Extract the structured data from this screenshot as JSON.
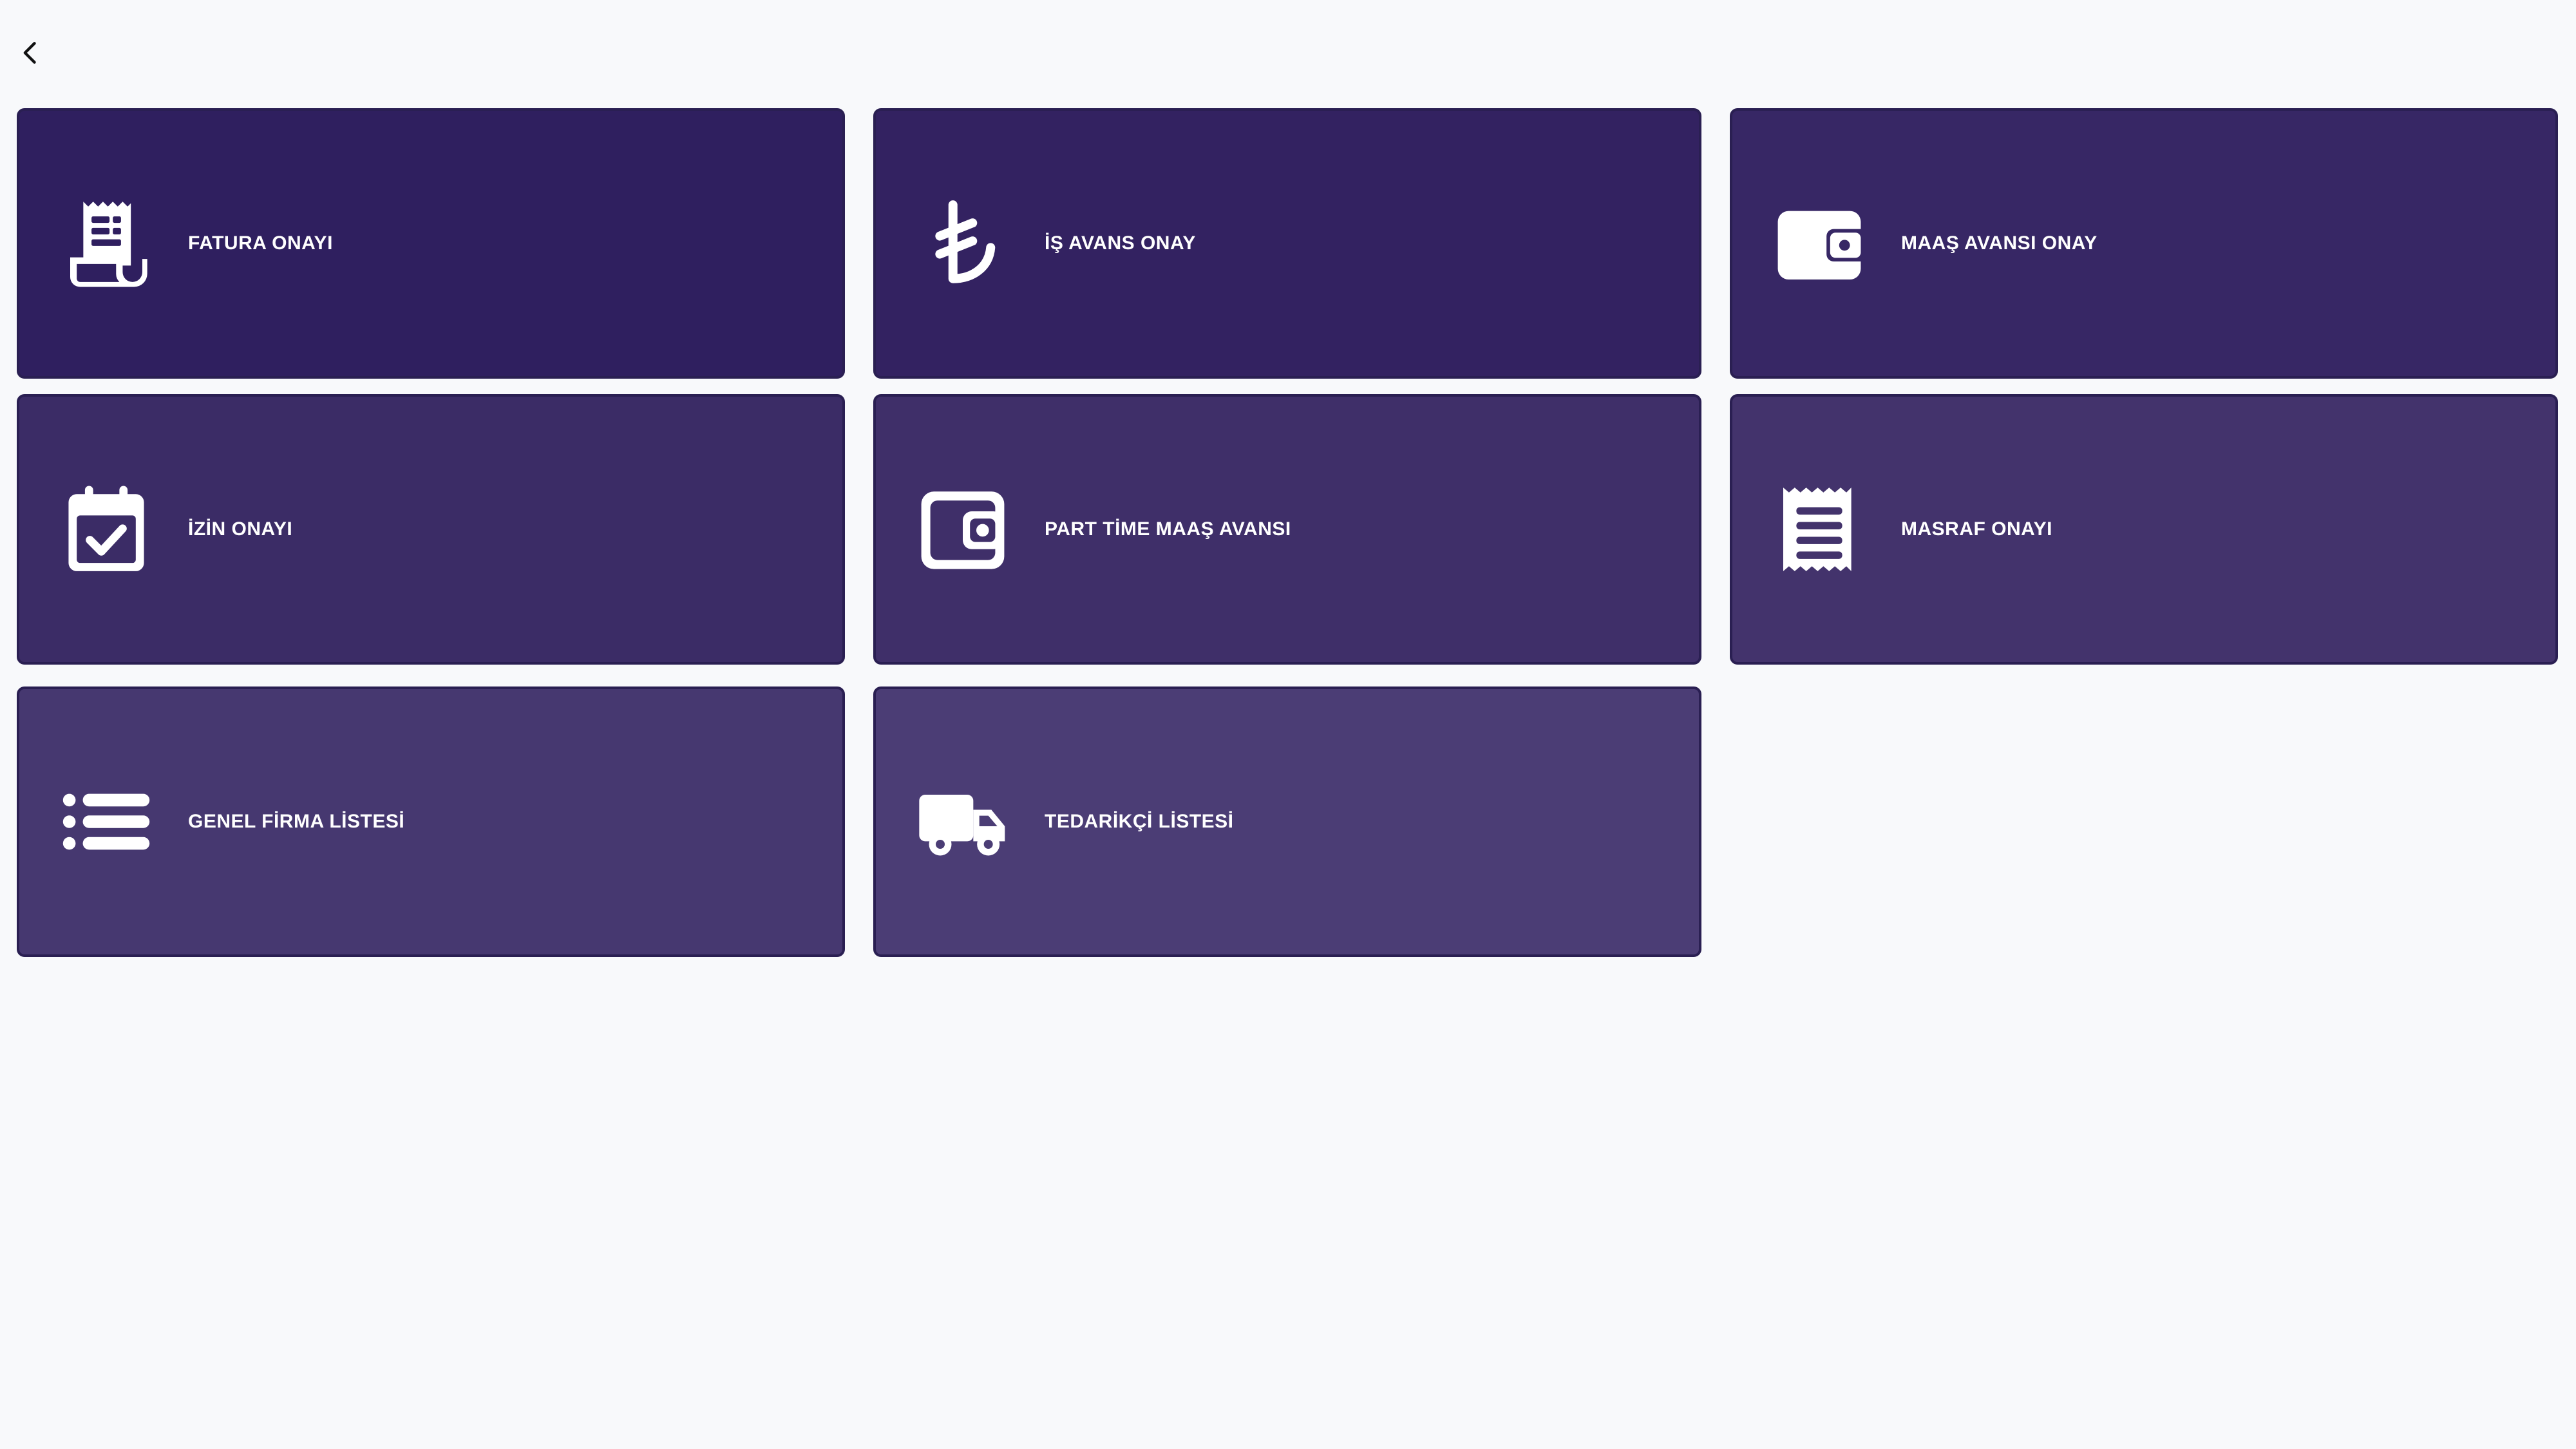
{
  "toolbar": {
    "back_icon": "chevron-left-icon"
  },
  "tiles": [
    {
      "label": "FATURA ONAYI",
      "icon": "invoice-receipt-icon"
    },
    {
      "label": "İŞ AVANS ONAY",
      "icon": "turkish-lira-icon"
    },
    {
      "label": "MAAŞ AVANSI ONAY",
      "icon": "wallet-icon"
    },
    {
      "label": "İZİN ONAYI",
      "icon": "calendar-check-icon"
    },
    {
      "label": "PART TİME MAAŞ AVANSI",
      "icon": "wallet-outline-icon"
    },
    {
      "label": "MASRAF ONAYI",
      "icon": "receipt-icon"
    },
    {
      "label": "GENEL FİRMA LİSTESİ",
      "icon": "list-icon"
    },
    {
      "label": "TEDARİKÇİ LİSTESİ",
      "icon": "truck-icon"
    }
  ],
  "colors": {
    "background": "#f8f9fb",
    "tile_dark": "#2f1f5f",
    "tile_light": "#4b3d75",
    "text": "#ffffff"
  }
}
